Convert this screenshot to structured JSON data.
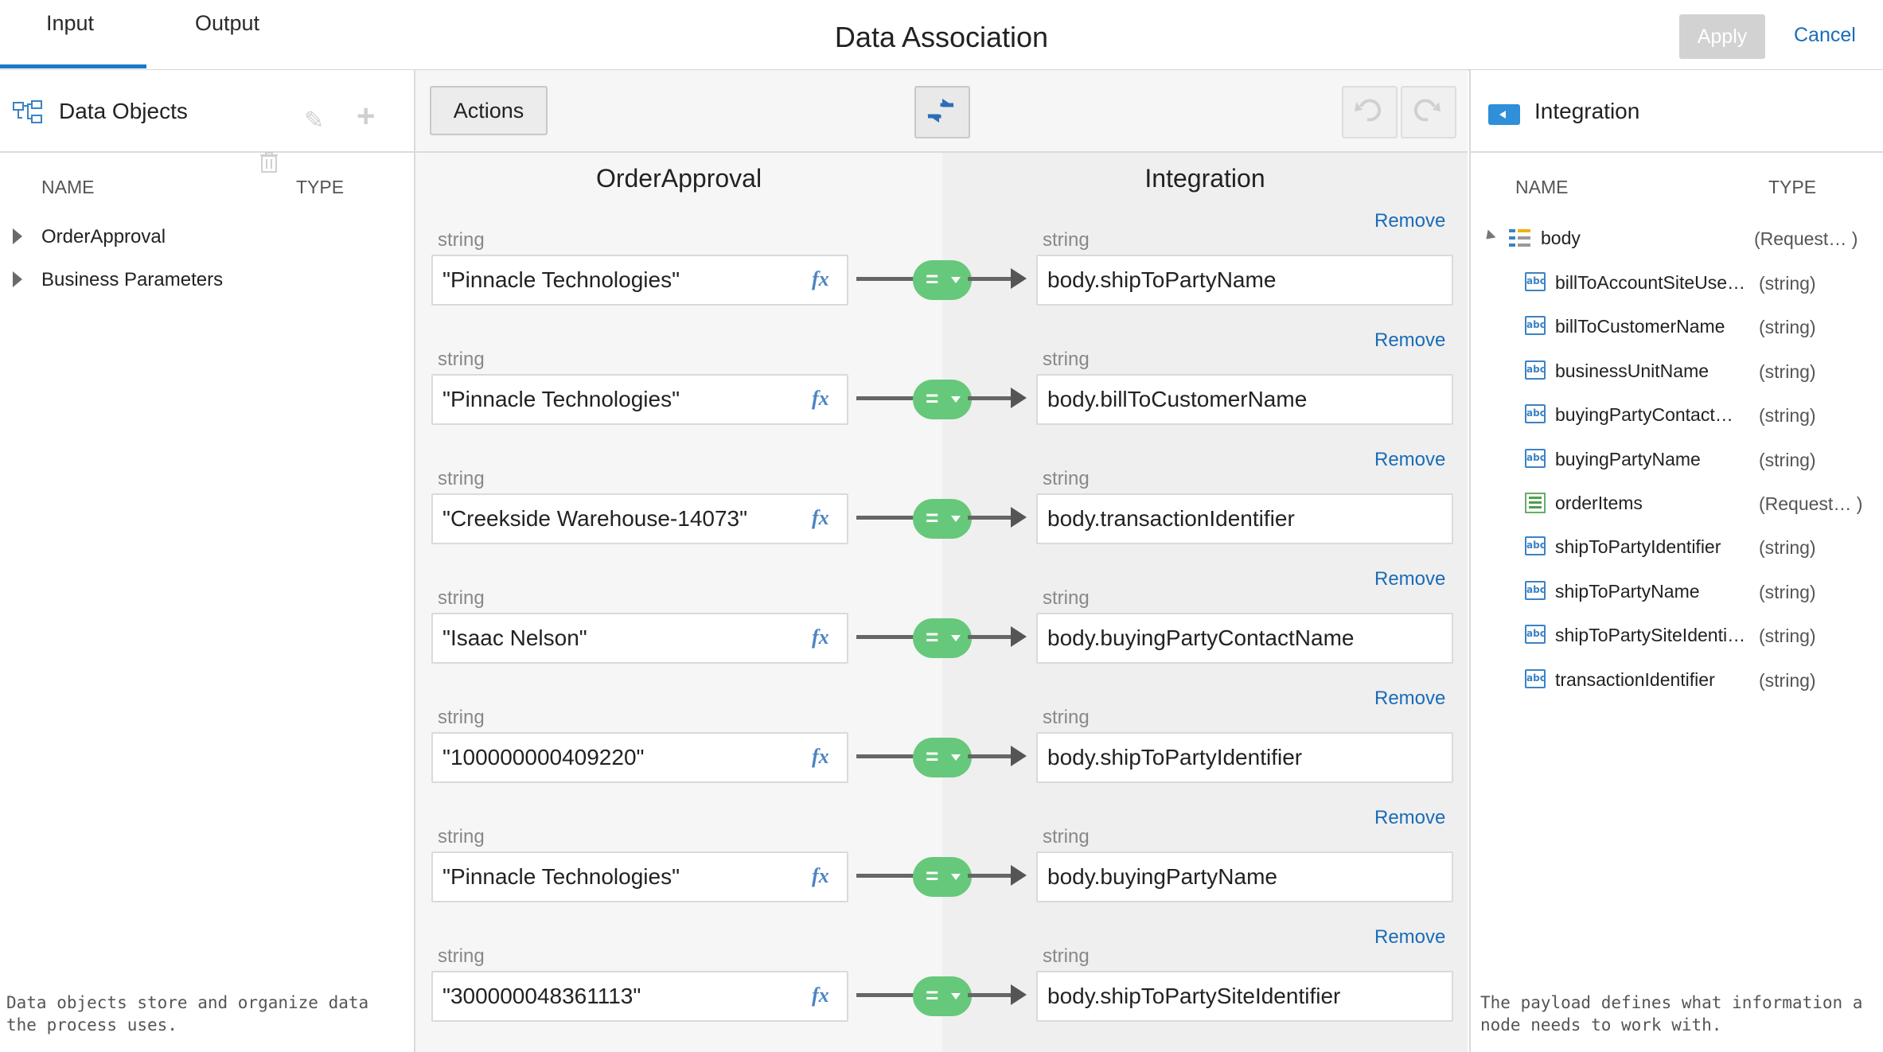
{
  "header": {
    "tabs": [
      {
        "label": "Input",
        "active": true
      },
      {
        "label": "Output",
        "active": false
      }
    ],
    "title": "Data Association",
    "apply_label": "Apply",
    "cancel_label": "Cancel"
  },
  "left_panel": {
    "title": "Data Objects",
    "columns": {
      "name": "NAME",
      "type": "TYPE"
    },
    "items": [
      {
        "label": "OrderApproval"
      },
      {
        "label": "Business Parameters"
      }
    ],
    "footer": "Data objects store and organize data the process uses."
  },
  "mapping": {
    "actions_label": "Actions",
    "source_title": "OrderApproval",
    "target_title": "Integration",
    "remove_label": "Remove",
    "rows": [
      {
        "source_type": "string",
        "source": "\"Pinnacle Technologies\"",
        "operator": "=",
        "target_type": "string",
        "target": "body.shipToPartyName"
      },
      {
        "source_type": "string",
        "source": "\"Pinnacle Technologies\"",
        "operator": "=",
        "target_type": "string",
        "target": "body.billToCustomerName"
      },
      {
        "source_type": "string",
        "source": "\"Creekside Warehouse-14073\"",
        "operator": "=",
        "target_type": "string",
        "target": "body.transactionIdentifier"
      },
      {
        "source_type": "string",
        "source": "\"Isaac Nelson\"",
        "operator": "=",
        "target_type": "string",
        "target": "body.buyingPartyContactName"
      },
      {
        "source_type": "string",
        "source": "\"100000000409220\"",
        "operator": "=",
        "target_type": "string",
        "target": "body.shipToPartyIdentifier"
      },
      {
        "source_type": "string",
        "source": "\"Pinnacle Technologies\"",
        "operator": "=",
        "target_type": "string",
        "target": "body.buyingPartyName"
      },
      {
        "source_type": "string",
        "source": "\"300000048361113\"",
        "operator": "=",
        "target_type": "string",
        "target": "body.shipToPartySiteIdentifier"
      }
    ]
  },
  "right_panel": {
    "title": "Integration",
    "columns": {
      "name": "NAME",
      "type": "TYPE"
    },
    "root": {
      "label": "body",
      "type": "(Request…  )"
    },
    "fields": [
      {
        "label": "billToAccountSiteUse…",
        "type": "(string)",
        "icon": "abc"
      },
      {
        "label": "billToCustomerName",
        "type": "(string)",
        "icon": "abc"
      },
      {
        "label": "businessUnitName",
        "type": "(string)",
        "icon": "abc"
      },
      {
        "label": "buyingPartyContact…",
        "type": "(string)",
        "icon": "abc"
      },
      {
        "label": "buyingPartyName",
        "type": "(string)",
        "icon": "abc"
      },
      {
        "label": "orderItems",
        "type": "(Request…  )",
        "icon": "collection"
      },
      {
        "label": "shipToPartyIdentifier",
        "type": "(string)",
        "icon": "abc"
      },
      {
        "label": "shipToPartyName",
        "type": "(string)",
        "icon": "abc"
      },
      {
        "label": "shipToPartySiteIdenti…",
        "type": "(string)",
        "icon": "abc"
      },
      {
        "label": "transactionIdentifier",
        "type": "(string)",
        "icon": "abc"
      }
    ],
    "footer": "The payload defines what information a node needs to work with."
  },
  "colors": {
    "accent": "#1a79c8",
    "link": "#1a6cb8",
    "operator": "#66c87a"
  }
}
